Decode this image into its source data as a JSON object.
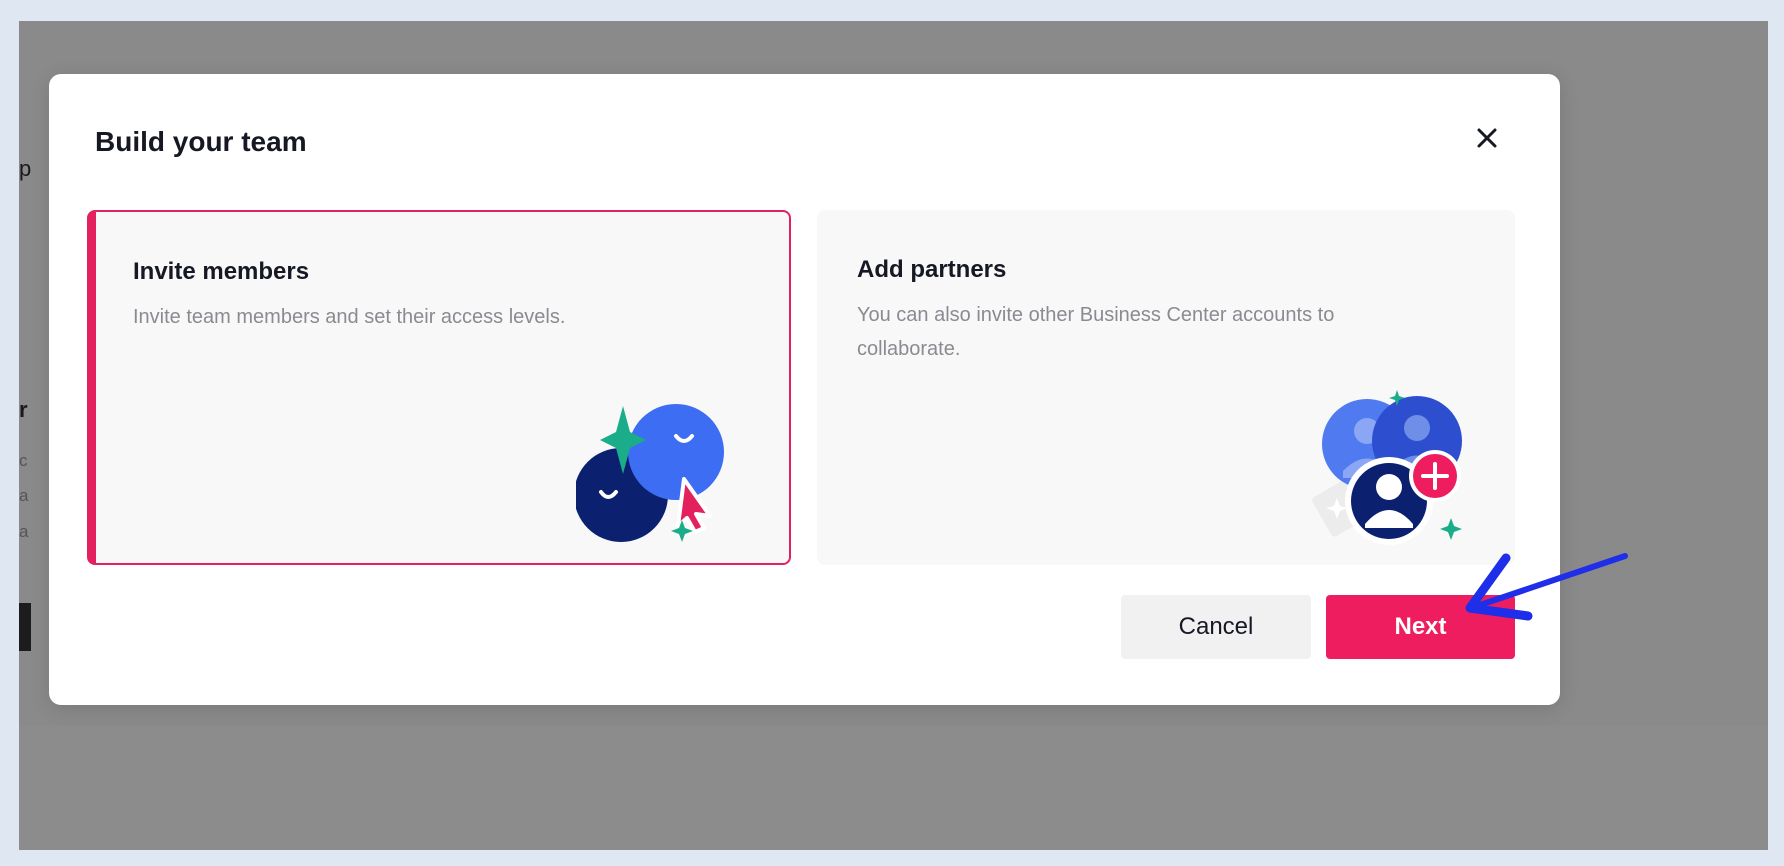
{
  "background": {
    "fragments": [
      "p",
      "r",
      "c",
      "a",
      "a"
    ]
  },
  "modal": {
    "title": "Build your team",
    "close_icon": "close-icon",
    "cards": [
      {
        "title": "Invite members",
        "description": "Invite team members and set their access levels.",
        "selected": true,
        "icon": "invite-members-illustration"
      },
      {
        "title": "Add partners",
        "description": "You can also invite other Business Center accounts to collaborate.",
        "selected": false,
        "icon": "add-partners-illustration"
      }
    ],
    "buttons": {
      "cancel": "Cancel",
      "next": "Next"
    }
  },
  "colors": {
    "accent": "#ee1d5f",
    "selected_border": "#e4215f",
    "annotation_arrow": "#1f2ee8"
  }
}
